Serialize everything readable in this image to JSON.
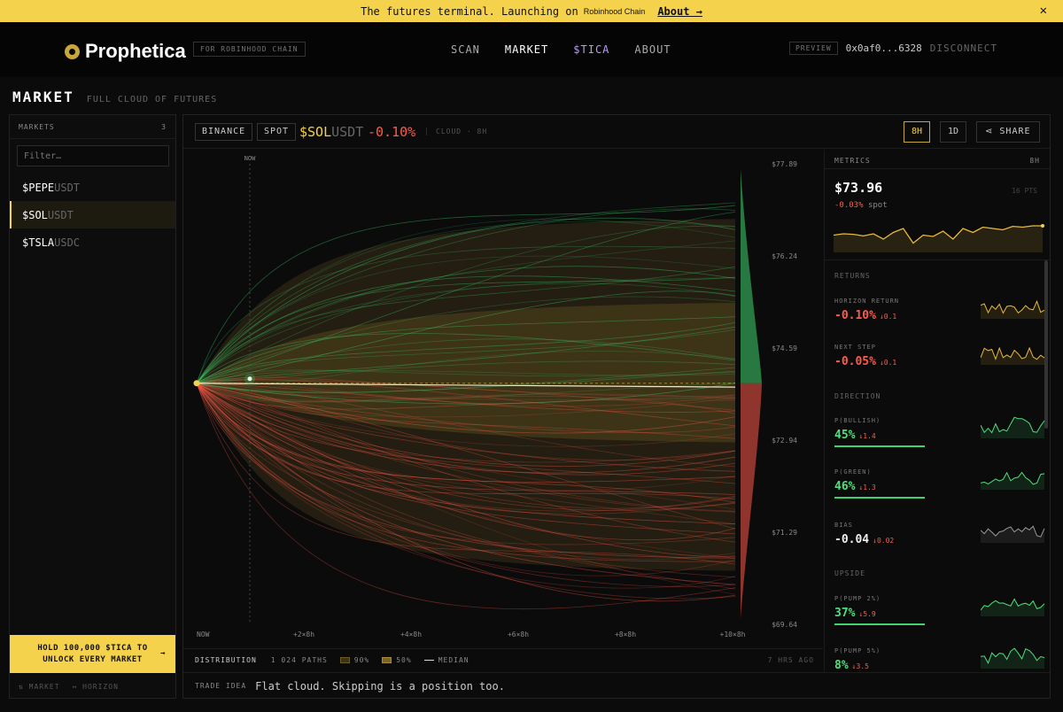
{
  "banner": {
    "text": "The futures terminal. Launching on",
    "chain_logo": "Robinhood Chain",
    "link": "About →",
    "close": "✕"
  },
  "nav": {
    "brand": "Prophetica",
    "chain_badge": "FOR ROBINHOOD CHAIN",
    "links": [
      "SCAN",
      "MARKET",
      "$TICA",
      "ABOUT"
    ],
    "active": "MARKET",
    "preview_badge": "PREVIEW",
    "wallet": "0x0af0...6328",
    "disconnect": "DISCONNECT"
  },
  "page": {
    "title": "MARKET",
    "subtitle": "FULL CLOUD OF FUTURES"
  },
  "sidebar": {
    "header": "MARKETS",
    "count": "3",
    "filter_placeholder": "Filter…",
    "markets": [
      {
        "base": "$PEPE",
        "quote": "USDT",
        "selected": false
      },
      {
        "base": "$SOL",
        "quote": "USDT",
        "selected": true
      },
      {
        "base": "$TSLA",
        "quote": "USDC",
        "selected": false
      }
    ],
    "unlock_line1": "HOLD 100,000 $TICA TO",
    "unlock_line2": "UNLOCK EVERY MARKET",
    "unlock_arrow": "→",
    "hint_market": "⇅ MARKET",
    "hint_horizon": "↔ HORIZON"
  },
  "toolbar": {
    "exchange": "BINANCE",
    "mode": "SPOT",
    "base": "$SOL",
    "quote": "USDT",
    "change": "-0.10%",
    "cloud_label": "CLOUD · 8H",
    "timeframes": [
      "8H",
      "1D"
    ],
    "active_timeframe": "8H",
    "share": "SHARE"
  },
  "chart_data": {
    "type": "line",
    "title": "",
    "now_label": "NOW",
    "x_ticks": [
      "NOW",
      "+2×8h",
      "+4×8h",
      "+6×8h",
      "+8×8h",
      "+10×8h"
    ],
    "y_ticks": [
      "$77.89",
      "$76.24",
      "$74.59",
      "$72.94",
      "$71.29",
      "$69.64"
    ],
    "ylim": [
      69.64,
      77.89
    ],
    "start_price": 73.96,
    "median_end": 73.89,
    "band_90": {
      "upper_end": 76.9,
      "lower_end": 70.6
    },
    "band_50": {
      "upper_end": 75.4,
      "lower_end": 72.9
    },
    "paths": 1024,
    "colors": {
      "up": "#3fd46f",
      "down": "#ff5a4a",
      "band": "#c9a63a",
      "median": "#f2e6c8",
      "start": "#f5d24b"
    }
  },
  "distribution": {
    "label": "DISTRIBUTION",
    "paths": "1 024 PATHS",
    "band90": "90%",
    "band50": "50%",
    "median": "MEDIAN",
    "ago": "7 HRS AGO"
  },
  "idea": {
    "label": "TRADE IDEA",
    "text": "Flat cloud. Skipping is a position too."
  },
  "metrics": {
    "header": "METRICS",
    "horizon": "8H",
    "price": "$73.96",
    "pts": "16 PTS",
    "spot_change": "-0.03%",
    "spot_label": "spot",
    "price_spark": [
      0.55,
      0.5,
      0.52,
      0.58,
      0.5,
      0.7,
      0.45,
      0.3,
      0.85,
      0.55,
      0.6,
      0.4,
      0.7,
      0.3,
      0.45,
      0.25,
      0.3,
      0.35,
      0.22,
      0.25,
      0.2,
      0.2
    ],
    "sections": {
      "returns": "RETURNS",
      "direction": "DIRECTION",
      "upside": "UPSIDE"
    },
    "rows": [
      {
        "label": "HORIZON RETURN",
        "value": "-0.10%",
        "delta": "↓0.1",
        "tone": "red"
      },
      {
        "label": "NEXT STEP",
        "value": "-0.05%",
        "delta": "↓0.1",
        "tone": "red"
      },
      {
        "label": "P(BULLISH)",
        "value": "45%",
        "delta": "↓1.4",
        "tone": "green",
        "bar": 0.45
      },
      {
        "label": "P(GREEN)",
        "value": "46%",
        "delta": "↓1.3",
        "tone": "green",
        "bar": 0.46
      },
      {
        "label": "BIAS",
        "value": "-0.04",
        "delta": "↓0.02",
        "tone": "white"
      },
      {
        "label": "P(PUMP 2%)",
        "value": "37%",
        "delta": "↓5.9",
        "tone": "green",
        "bar": 0.37
      },
      {
        "label": "P(PUMP 5%)",
        "value": "8%",
        "delta": "↓3.5",
        "tone": "green",
        "bar": 0.08
      }
    ]
  }
}
